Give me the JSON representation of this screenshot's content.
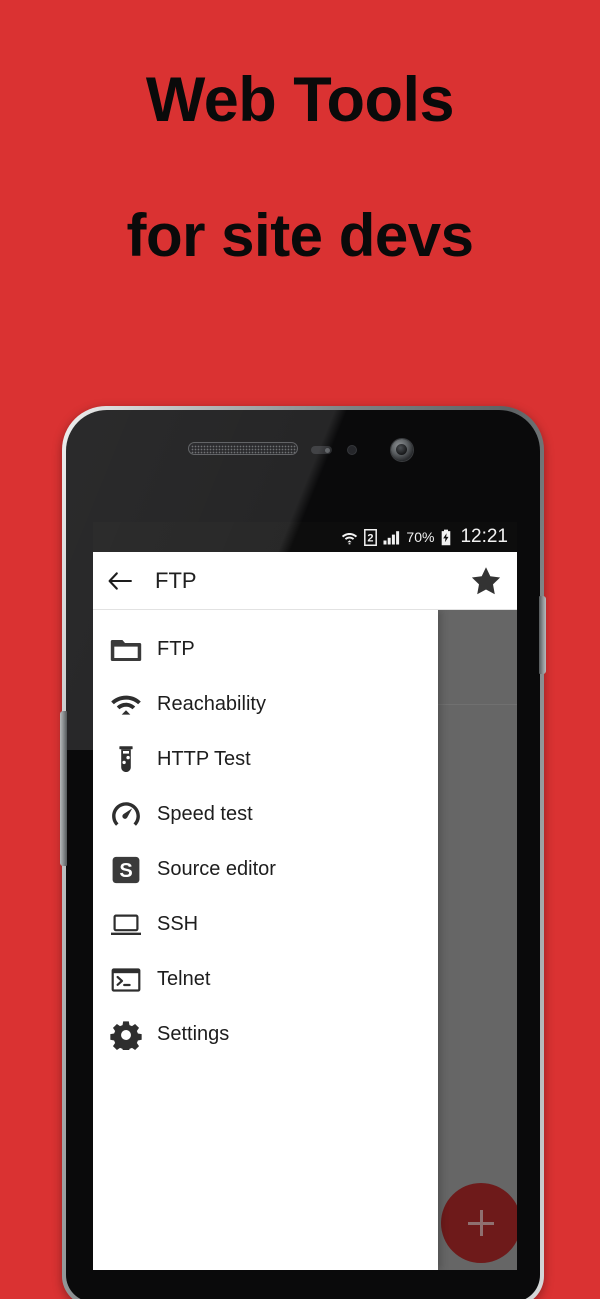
{
  "promo": {
    "background_color": "#da3232",
    "headline_line1": "Web Tools",
    "headline_line2": "for site devs",
    "headline_color": "#0a0a0a"
  },
  "device": {
    "type": "android-phone",
    "hardware": {
      "earpiece": "earpiece-speaker",
      "proximity_sensor": "proximity-sensor",
      "front_camera": "front-camera",
      "volume_button": "volume-rocker",
      "power_button": "power-button"
    }
  },
  "screen": {
    "statusbar": {
      "background_color": "#0d0d0d",
      "wifi_icon": "wifi-icon",
      "sim_indicator": "2",
      "signal_icon": "signal-bars-icon",
      "battery_percent": "70%",
      "battery_icon": "battery-charging-icon",
      "clock": "12:21"
    },
    "appbar": {
      "back_icon": "back-arrow-icon",
      "title": "FTP",
      "favorite_icon": "star-filled-icon",
      "background_color": "#ffffff"
    },
    "drawer": {
      "background_color": "#ffffff",
      "items": [
        {
          "label": "FTP",
          "icon": "folder-icon"
        },
        {
          "label": "Reachability",
          "icon": "wifi-icon"
        },
        {
          "label": "HTTP Test",
          "icon": "test-tube-icon"
        },
        {
          "label": "Speed test",
          "icon": "speedometer-icon"
        },
        {
          "label": "Source editor",
          "icon": "source-editor-icon"
        },
        {
          "label": "SSH",
          "icon": "laptop-icon"
        },
        {
          "label": "Telnet",
          "icon": "terminal-icon"
        },
        {
          "label": "Settings",
          "icon": "gear-icon"
        }
      ]
    },
    "scrim": {
      "color": "#666666"
    },
    "fab": {
      "icon": "plus-icon",
      "color": "#6e1a1a"
    }
  }
}
